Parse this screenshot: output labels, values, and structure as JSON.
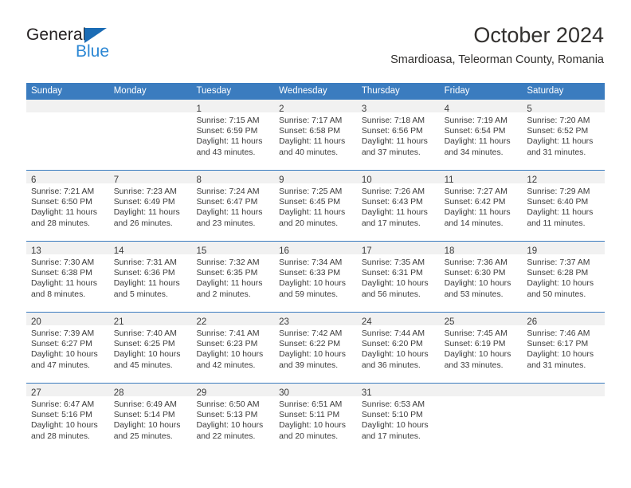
{
  "brand": {
    "name_top": "General",
    "name_bottom": "Blue",
    "triangle_color": "#1b6cb5",
    "blue_text_color": "#2b87d4"
  },
  "header": {
    "title": "October 2024",
    "subtitle": "Smardioasa, Teleorman County, Romania"
  },
  "theme": {
    "header_blue": "#3b7cbf",
    "day_band_gray": "#f1f1f1",
    "text_color": "#3b3b3b"
  },
  "weekdays": [
    "Sunday",
    "Monday",
    "Tuesday",
    "Wednesday",
    "Thursday",
    "Friday",
    "Saturday"
  ],
  "weeks": [
    [
      {
        "day": "",
        "lines": []
      },
      {
        "day": "",
        "lines": []
      },
      {
        "day": "1",
        "lines": [
          "Sunrise: 7:15 AM",
          "Sunset: 6:59 PM",
          "Daylight: 11 hours",
          "and 43 minutes."
        ]
      },
      {
        "day": "2",
        "lines": [
          "Sunrise: 7:17 AM",
          "Sunset: 6:58 PM",
          "Daylight: 11 hours",
          "and 40 minutes."
        ]
      },
      {
        "day": "3",
        "lines": [
          "Sunrise: 7:18 AM",
          "Sunset: 6:56 PM",
          "Daylight: 11 hours",
          "and 37 minutes."
        ]
      },
      {
        "day": "4",
        "lines": [
          "Sunrise: 7:19 AM",
          "Sunset: 6:54 PM",
          "Daylight: 11 hours",
          "and 34 minutes."
        ]
      },
      {
        "day": "5",
        "lines": [
          "Sunrise: 7:20 AM",
          "Sunset: 6:52 PM",
          "Daylight: 11 hours",
          "and 31 minutes."
        ]
      }
    ],
    [
      {
        "day": "6",
        "lines": [
          "Sunrise: 7:21 AM",
          "Sunset: 6:50 PM",
          "Daylight: 11 hours",
          "and 28 minutes."
        ]
      },
      {
        "day": "7",
        "lines": [
          "Sunrise: 7:23 AM",
          "Sunset: 6:49 PM",
          "Daylight: 11 hours",
          "and 26 minutes."
        ]
      },
      {
        "day": "8",
        "lines": [
          "Sunrise: 7:24 AM",
          "Sunset: 6:47 PM",
          "Daylight: 11 hours",
          "and 23 minutes."
        ]
      },
      {
        "day": "9",
        "lines": [
          "Sunrise: 7:25 AM",
          "Sunset: 6:45 PM",
          "Daylight: 11 hours",
          "and 20 minutes."
        ]
      },
      {
        "day": "10",
        "lines": [
          "Sunrise: 7:26 AM",
          "Sunset: 6:43 PM",
          "Daylight: 11 hours",
          "and 17 minutes."
        ]
      },
      {
        "day": "11",
        "lines": [
          "Sunrise: 7:27 AM",
          "Sunset: 6:42 PM",
          "Daylight: 11 hours",
          "and 14 minutes."
        ]
      },
      {
        "day": "12",
        "lines": [
          "Sunrise: 7:29 AM",
          "Sunset: 6:40 PM",
          "Daylight: 11 hours",
          "and 11 minutes."
        ]
      }
    ],
    [
      {
        "day": "13",
        "lines": [
          "Sunrise: 7:30 AM",
          "Sunset: 6:38 PM",
          "Daylight: 11 hours",
          "and 8 minutes."
        ]
      },
      {
        "day": "14",
        "lines": [
          "Sunrise: 7:31 AM",
          "Sunset: 6:36 PM",
          "Daylight: 11 hours",
          "and 5 minutes."
        ]
      },
      {
        "day": "15",
        "lines": [
          "Sunrise: 7:32 AM",
          "Sunset: 6:35 PM",
          "Daylight: 11 hours",
          "and 2 minutes."
        ]
      },
      {
        "day": "16",
        "lines": [
          "Sunrise: 7:34 AM",
          "Sunset: 6:33 PM",
          "Daylight: 10 hours",
          "and 59 minutes."
        ]
      },
      {
        "day": "17",
        "lines": [
          "Sunrise: 7:35 AM",
          "Sunset: 6:31 PM",
          "Daylight: 10 hours",
          "and 56 minutes."
        ]
      },
      {
        "day": "18",
        "lines": [
          "Sunrise: 7:36 AM",
          "Sunset: 6:30 PM",
          "Daylight: 10 hours",
          "and 53 minutes."
        ]
      },
      {
        "day": "19",
        "lines": [
          "Sunrise: 7:37 AM",
          "Sunset: 6:28 PM",
          "Daylight: 10 hours",
          "and 50 minutes."
        ]
      }
    ],
    [
      {
        "day": "20",
        "lines": [
          "Sunrise: 7:39 AM",
          "Sunset: 6:27 PM",
          "Daylight: 10 hours",
          "and 47 minutes."
        ]
      },
      {
        "day": "21",
        "lines": [
          "Sunrise: 7:40 AM",
          "Sunset: 6:25 PM",
          "Daylight: 10 hours",
          "and 45 minutes."
        ]
      },
      {
        "day": "22",
        "lines": [
          "Sunrise: 7:41 AM",
          "Sunset: 6:23 PM",
          "Daylight: 10 hours",
          "and 42 minutes."
        ]
      },
      {
        "day": "23",
        "lines": [
          "Sunrise: 7:42 AM",
          "Sunset: 6:22 PM",
          "Daylight: 10 hours",
          "and 39 minutes."
        ]
      },
      {
        "day": "24",
        "lines": [
          "Sunrise: 7:44 AM",
          "Sunset: 6:20 PM",
          "Daylight: 10 hours",
          "and 36 minutes."
        ]
      },
      {
        "day": "25",
        "lines": [
          "Sunrise: 7:45 AM",
          "Sunset: 6:19 PM",
          "Daylight: 10 hours",
          "and 33 minutes."
        ]
      },
      {
        "day": "26",
        "lines": [
          "Sunrise: 7:46 AM",
          "Sunset: 6:17 PM",
          "Daylight: 10 hours",
          "and 31 minutes."
        ]
      }
    ],
    [
      {
        "day": "27",
        "lines": [
          "Sunrise: 6:47 AM",
          "Sunset: 5:16 PM",
          "Daylight: 10 hours",
          "and 28 minutes."
        ]
      },
      {
        "day": "28",
        "lines": [
          "Sunrise: 6:49 AM",
          "Sunset: 5:14 PM",
          "Daylight: 10 hours",
          "and 25 minutes."
        ]
      },
      {
        "day": "29",
        "lines": [
          "Sunrise: 6:50 AM",
          "Sunset: 5:13 PM",
          "Daylight: 10 hours",
          "and 22 minutes."
        ]
      },
      {
        "day": "30",
        "lines": [
          "Sunrise: 6:51 AM",
          "Sunset: 5:11 PM",
          "Daylight: 10 hours",
          "and 20 minutes."
        ]
      },
      {
        "day": "31",
        "lines": [
          "Sunrise: 6:53 AM",
          "Sunset: 5:10 PM",
          "Daylight: 10 hours",
          "and 17 minutes."
        ]
      },
      {
        "day": "",
        "lines": []
      },
      {
        "day": "",
        "lines": []
      }
    ]
  ]
}
